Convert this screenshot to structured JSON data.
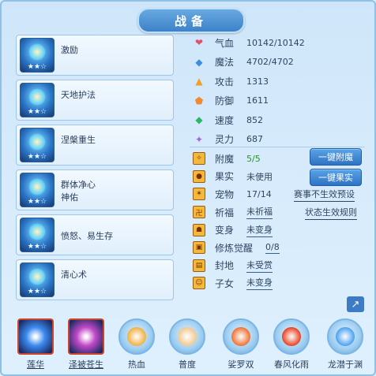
{
  "title": "战备",
  "skills": [
    {
      "name": "激励",
      "stars": "★★☆"
    },
    {
      "name": "天地护法",
      "stars": "★★☆"
    },
    {
      "name": "涅槃重生",
      "stars": "★★☆"
    },
    {
      "name": "群体净心",
      "name2": "神佑",
      "stars": "★★☆"
    },
    {
      "name": "愤怒、易生存",
      "stars": "★★☆"
    },
    {
      "name": "清心术",
      "stars": "★★☆"
    }
  ],
  "stats": [
    {
      "label": "气血",
      "value": "10142/10142",
      "icon": "heart-icon",
      "glyph": "❤",
      "color": "#e2506a"
    },
    {
      "label": "魔法",
      "value": "4702/4702",
      "icon": "mana-icon",
      "glyph": "◆",
      "color": "#3b8fe0"
    },
    {
      "label": "攻击",
      "value": "1313",
      "icon": "attack-icon",
      "glyph": "▲",
      "color": "#f0a020"
    },
    {
      "label": "防御",
      "value": "1611",
      "icon": "defense-icon",
      "glyph": "⬟",
      "color": "#f08a30"
    },
    {
      "label": "速度",
      "value": "852",
      "icon": "speed-icon",
      "glyph": "◆",
      "color": "#28b868"
    },
    {
      "label": "灵力",
      "value": "687",
      "icon": "spirit-icon",
      "glyph": "✦",
      "color": "#a068d8"
    }
  ],
  "attrs": [
    {
      "label": "附魔",
      "value": "5/5",
      "icon": "enchant-icon",
      "glyph": "✧",
      "green": true,
      "underline": false
    },
    {
      "label": "果实",
      "value": "未使用",
      "icon": "fruit-icon",
      "glyph": "●",
      "green": false,
      "underline": false
    },
    {
      "label": "宠物",
      "value": "17/14",
      "icon": "pet-icon",
      "glyph": "✶",
      "green": false,
      "underline": false
    },
    {
      "label": "祈福",
      "value": "未祈福",
      "icon": "blessing-icon",
      "glyph": "卍",
      "green": false,
      "underline": true
    },
    {
      "label": "变身",
      "value": "未变身",
      "icon": "transform-icon",
      "glyph": "☗",
      "green": false,
      "underline": true
    },
    {
      "label": "修炼觉醒",
      "value": "0/8",
      "icon": "cultivation-icon",
      "glyph": "▣",
      "green": false,
      "underline": true
    },
    {
      "label": "封地",
      "value": "未受赏",
      "icon": "fief-icon",
      "glyph": "▤",
      "green": false,
      "underline": true
    },
    {
      "label": "子女",
      "value": "未变身",
      "icon": "child-icon",
      "glyph": "☺",
      "green": false,
      "underline": true
    }
  ],
  "buttons": {
    "enchant_all": "一键附魔",
    "fruit_all": "一键果实"
  },
  "links": {
    "preset": "赛事不生效预设",
    "rules": "状态生效规则"
  },
  "bottom": [
    {
      "label": "莲华",
      "kind": "square",
      "inner": "#3b8af0"
    },
    {
      "label": "泽被苍生",
      "kind": "square",
      "inner": "#c048c8"
    },
    {
      "label": "热血",
      "kind": "circle",
      "inner": "#f0b040"
    },
    {
      "label": "普度",
      "kind": "circle",
      "inner": "#f0c890"
    },
    {
      "label": "娑罗双",
      "kind": "circle",
      "inner": "#f07030"
    },
    {
      "label": "春风化雨",
      "kind": "circle",
      "inner": "#e84020"
    },
    {
      "label": "龙潜于渊",
      "kind": "circle",
      "inner": "#4aa0f0"
    }
  ]
}
